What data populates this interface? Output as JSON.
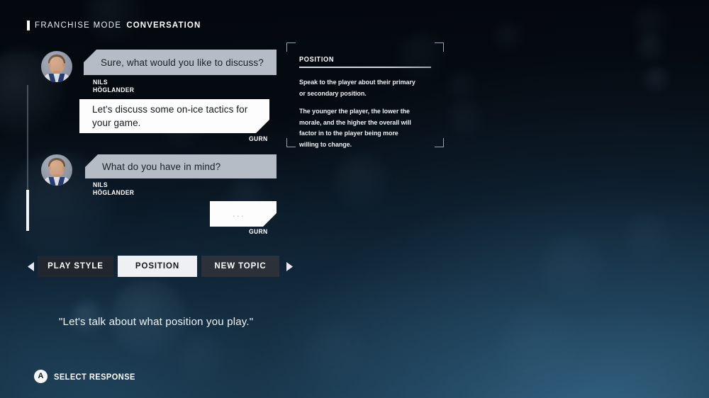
{
  "header": {
    "mode_label": "FRANCHISE MODE",
    "screen_label": "CONVERSATION"
  },
  "conversation": {
    "messages": [
      {
        "speaker": "NILS HÖGLANDER",
        "text": "Sure, what would you like to discuss?",
        "side": "npc",
        "has_avatar": true
      },
      {
        "speaker": "GURN",
        "text": "Let's discuss some on-ice tactics for your game.",
        "side": "user",
        "has_avatar": false
      },
      {
        "speaker": "NILS HÖGLANDER",
        "text": "What do you have in mind?",
        "side": "npc",
        "has_avatar": true
      },
      {
        "speaker": "GURN",
        "text": "...",
        "side": "user",
        "has_avatar": false
      }
    ]
  },
  "info_panel": {
    "title": "POSITION",
    "paragraph_1": "Speak to the player about their primary or secondary position.",
    "paragraph_2": "The younger the player, the lower the morale, and the higher the overall will factor in to the player being more willing to change."
  },
  "tabs": {
    "prev_icon": "chevron-left-icon",
    "next_icon": "chevron-right-icon",
    "items": [
      {
        "label": "PLAY STYLE",
        "selected": false
      },
      {
        "label": "POSITION",
        "selected": true
      },
      {
        "label": "NEW TOPIC",
        "selected": false
      }
    ]
  },
  "quote": {
    "text": "\"Let's talk about what position you play.\""
  },
  "footer": {
    "button_glyph": "A",
    "action_label": "SELECT RESPONSE"
  },
  "colors": {
    "accent_white": "#ffffff",
    "npc_bubble": "#b6bcc6",
    "user_bubble": "#fdfdfd",
    "tab_selected_bg": "#eef0f3",
    "tab_idle_bg": "#22262e",
    "background_deep": "#04070d",
    "background_glow": "#1d4058"
  }
}
